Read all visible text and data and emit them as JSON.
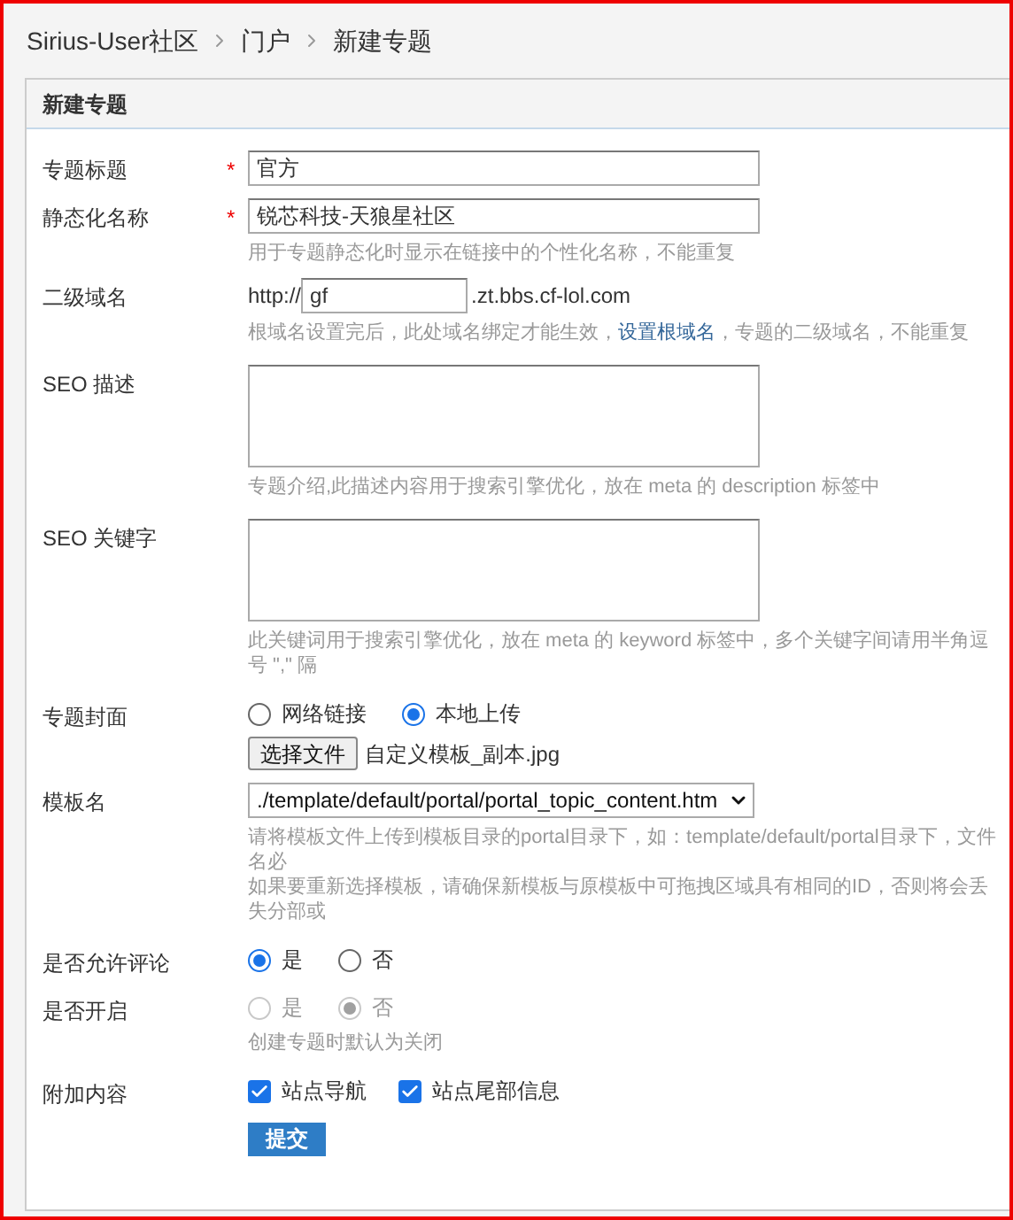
{
  "breadcrumb": [
    "Sirius-User社区",
    "门户",
    "新建专题"
  ],
  "panel": {
    "title": "新建专题"
  },
  "fields": [
    {
      "kind": "text",
      "label": "专题标题",
      "marker": "*",
      "value": "官方"
    },
    {
      "kind": "text",
      "label": "静态化名称",
      "marker": "*",
      "value": "锐芯科技-天狼星社区",
      "hint": "用于专题静态化时显示在链接中的个性化名称，不能重复"
    },
    {
      "kind": "domain",
      "label": "二级域名",
      "prefix": "http://",
      "value": "gf",
      "suffix": ".zt.bbs.cf-lol.com",
      "hint_before": "根域名设置完后，此处域名绑定才能生效，",
      "hint_link": "设置根域名",
      "hint_after": "，专题的二级域名，不能重复"
    },
    {
      "kind": "textarea",
      "label": "SEO 描述",
      "hint": "专题介绍,此描述内容用于搜索引擎优化，放在 meta 的 description 标签中"
    },
    {
      "kind": "textarea",
      "label": "SEO 关键字",
      "hint": "此关键词用于搜索引擎优化，放在 meta 的 keyword 标签中，多个关键字间请用半角逗号 \",\" 隔"
    },
    {
      "kind": "cover",
      "label": "专题封面",
      "options": [
        {
          "label": "网络链接",
          "selected": false
        },
        {
          "label": "本地上传",
          "selected": true
        }
      ],
      "button": "选择文件",
      "file": "自定义模板_副本.jpg"
    },
    {
      "kind": "select",
      "label": "模板名",
      "value": "./template/default/portal/portal_topic_content.htm",
      "hints": [
        "请将模板文件上传到模板目录的portal目录下，如：template/default/portal目录下，文件名必",
        "如果要重新选择模板，请确保新模板与原模板中可拖拽区域具有相同的ID，否则将会丢失分部或"
      ]
    },
    {
      "kind": "radio",
      "label": "是否允许评论",
      "disabled": false,
      "options": [
        {
          "label": "是",
          "selected": true
        },
        {
          "label": "否",
          "selected": false
        }
      ]
    },
    {
      "kind": "radio",
      "label": "是否开启",
      "disabled": true,
      "options": [
        {
          "label": "是",
          "selected": false
        },
        {
          "label": "否",
          "selected": true
        }
      ],
      "hint": "创建专题时默认为关闭"
    },
    {
      "kind": "checkbox",
      "label": "附加内容",
      "options": [
        {
          "label": "站点导航",
          "checked": true
        },
        {
          "label": "站点尾部信息",
          "checked": true
        }
      ]
    }
  ],
  "submit": "提交"
}
